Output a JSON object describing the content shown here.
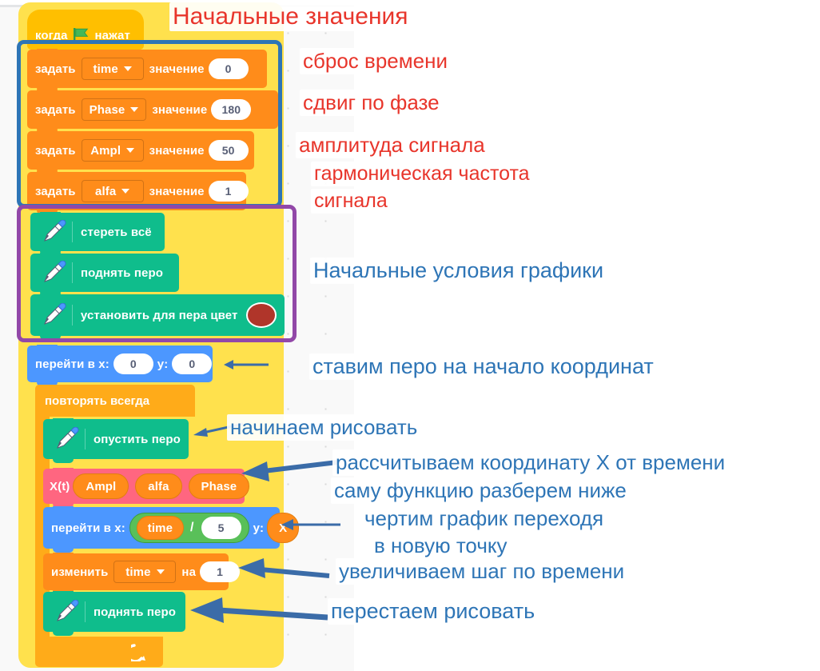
{
  "app": "scratch-block-editor",
  "workspace": {
    "script": {
      "hat": {
        "word1": "когда",
        "icon": "green-flag-icon",
        "word2": "нажат"
      },
      "set_blocks": [
        {
          "verb": "задать",
          "variable": "time",
          "label": "значение",
          "value": "0"
        },
        {
          "verb": "задать",
          "variable": "Phase",
          "label": "значение",
          "value": "180"
        },
        {
          "verb": "задать",
          "variable": "Ampl",
          "label": "значение",
          "value": "50"
        },
        {
          "verb": "задать",
          "variable": "alfa",
          "label": "значение",
          "value": "1"
        }
      ],
      "pen_blocks": [
        {
          "label": "стереть всё"
        },
        {
          "label": "поднять перо"
        },
        {
          "label": "установить для пера цвет",
          "color": "#b0352a"
        }
      ],
      "goto_start": {
        "label": "перейти в x:",
        "x": "0",
        "ylabel": "y:",
        "y": "0"
      },
      "forever": {
        "label": "повторять всегда",
        "loop_icon": "loop-arrow-icon"
      },
      "loop_body": {
        "pen_down": {
          "label": "опустить перо"
        },
        "custom_call": {
          "name": "X(t)",
          "args": [
            "Ampl",
            "alfa",
            "Phase"
          ]
        },
        "goto_draw": {
          "label": "перейти в x:",
          "operand_a": "time",
          "operator": "/",
          "operand_b": "5",
          "ylabel": "y:",
          "yvar": "X"
        },
        "change_var": {
          "verb": "изменить",
          "variable": "time",
          "label": "на",
          "value": "1"
        },
        "pen_up": {
          "label": "поднять перо"
        }
      }
    }
  },
  "highlights": {
    "blue_rect": {
      "color": "#2e75b6"
    },
    "purple_rect": {
      "color": "#9248a8"
    },
    "glow": {
      "color": "#ffe14d"
    }
  },
  "annotations": [
    {
      "id": "title",
      "text": "Начальные значения",
      "color": "red"
    },
    {
      "id": "reset-time",
      "text": "сброс времени",
      "color": "red"
    },
    {
      "id": "phase-shift",
      "text": "сдвиг по фазе",
      "color": "red"
    },
    {
      "id": "amplitude",
      "text": "амплитуда сигнала",
      "color": "red"
    },
    {
      "id": "harm-1",
      "text": "гармоническая частота",
      "color": "red"
    },
    {
      "id": "harm-2",
      "text": "сигнала",
      "color": "red"
    },
    {
      "id": "init-graph",
      "text": "Начальные условия графики",
      "color": "blue"
    },
    {
      "id": "pen-origin",
      "text": "ставим перо на  начало координат",
      "color": "blue"
    },
    {
      "id": "start-draw",
      "text": "начинаем рисовать",
      "color": "blue"
    },
    {
      "id": "calc-x",
      "text": "рассчитываем координату X от времени",
      "color": "blue"
    },
    {
      "id": "func-later",
      "text": "саму функцию разберем ниже",
      "color": "blue"
    },
    {
      "id": "draw-graph-1",
      "text": "чертим график переходя",
      "color": "blue"
    },
    {
      "id": "draw-graph-2",
      "text": "в новую точку",
      "color": "blue"
    },
    {
      "id": "time-step",
      "text": "увеличиваем шаг по времени",
      "color": "blue"
    },
    {
      "id": "stop-draw",
      "text": "перестаем рисовать",
      "color": "blue"
    }
  ]
}
